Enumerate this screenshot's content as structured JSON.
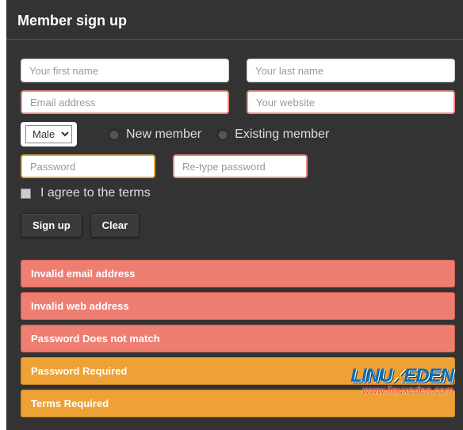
{
  "header": {
    "title": "Member sign up"
  },
  "fields": {
    "first_name": {
      "placeholder": "Your first name"
    },
    "last_name": {
      "placeholder": "Your last name"
    },
    "email": {
      "placeholder": "Email address"
    },
    "website": {
      "placeholder": "Your website"
    },
    "gender": {
      "selected": "Male"
    },
    "member_type": {
      "option_new": "New member",
      "option_existing": "Existing member"
    },
    "password": {
      "placeholder": "Password"
    },
    "password_confirm": {
      "placeholder": "Re-type password"
    },
    "terms_label": "I agree to the terms"
  },
  "buttons": {
    "submit": "Sign up",
    "clear": "Clear"
  },
  "alerts": [
    {
      "type": "error",
      "text": "Invalid email address"
    },
    {
      "type": "error",
      "text": "Invalid web address"
    },
    {
      "type": "error",
      "text": "Password Does not match"
    },
    {
      "type": "warning",
      "text": "Password Required"
    },
    {
      "type": "warning",
      "text": "Terms Required"
    }
  ],
  "watermark": {
    "logo_main": "LINU",
    "logo_accent1": "X",
    "logo_accent2": "EDEN",
    "url": "www.linuxeden.com"
  }
}
